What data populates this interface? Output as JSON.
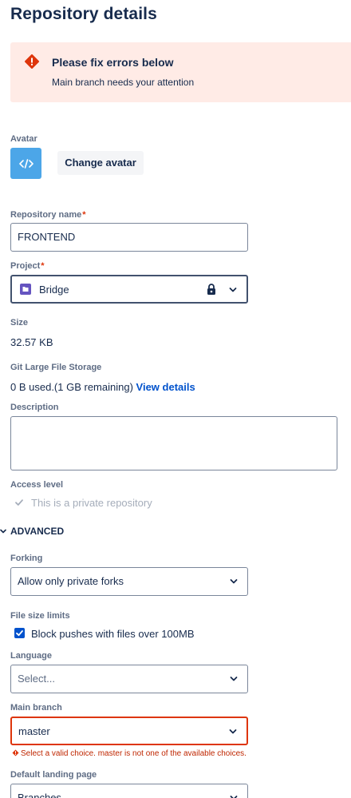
{
  "page": {
    "title": "Repository details"
  },
  "error_banner": {
    "title": "Please fix errors below",
    "message": "Main branch needs your attention"
  },
  "avatar": {
    "label": "Avatar",
    "change_button": "Change avatar"
  },
  "repository_name": {
    "label": "Repository name",
    "required": "*",
    "value": "FRONTEND"
  },
  "project": {
    "label": "Project",
    "required": "*",
    "value": "Bridge"
  },
  "size": {
    "label": "Size",
    "value": "32.57 KB"
  },
  "lfs": {
    "label": "Git Large File Storage",
    "text": "0 B used.(1 GB remaining)",
    "link": "View details"
  },
  "description": {
    "label": "Description",
    "value": ""
  },
  "access_level": {
    "label": "Access level",
    "checkbox_label": "This is a private repository",
    "checked": true,
    "disabled": true
  },
  "advanced": {
    "label": "ADVANCED"
  },
  "forking": {
    "label": "Forking",
    "value": "Allow only private forks"
  },
  "file_size_limits": {
    "label": "File size limits",
    "checkbox_label": "Block pushes with files over 100MB",
    "checked": true
  },
  "language": {
    "label": "Language",
    "placeholder": "Select..."
  },
  "main_branch": {
    "label": "Main branch",
    "value": "master",
    "error": "Select a valid choice. master is not one of the available choices."
  },
  "default_landing_page": {
    "label": "Default landing page",
    "value": "Branches"
  },
  "colors": {
    "error": "#de350b",
    "error_bg": "#ffebe6",
    "link": "#0052cc",
    "checkbox": "#0052cc",
    "avatar": "#4ca6e8",
    "project_icon": "#6554c0"
  }
}
